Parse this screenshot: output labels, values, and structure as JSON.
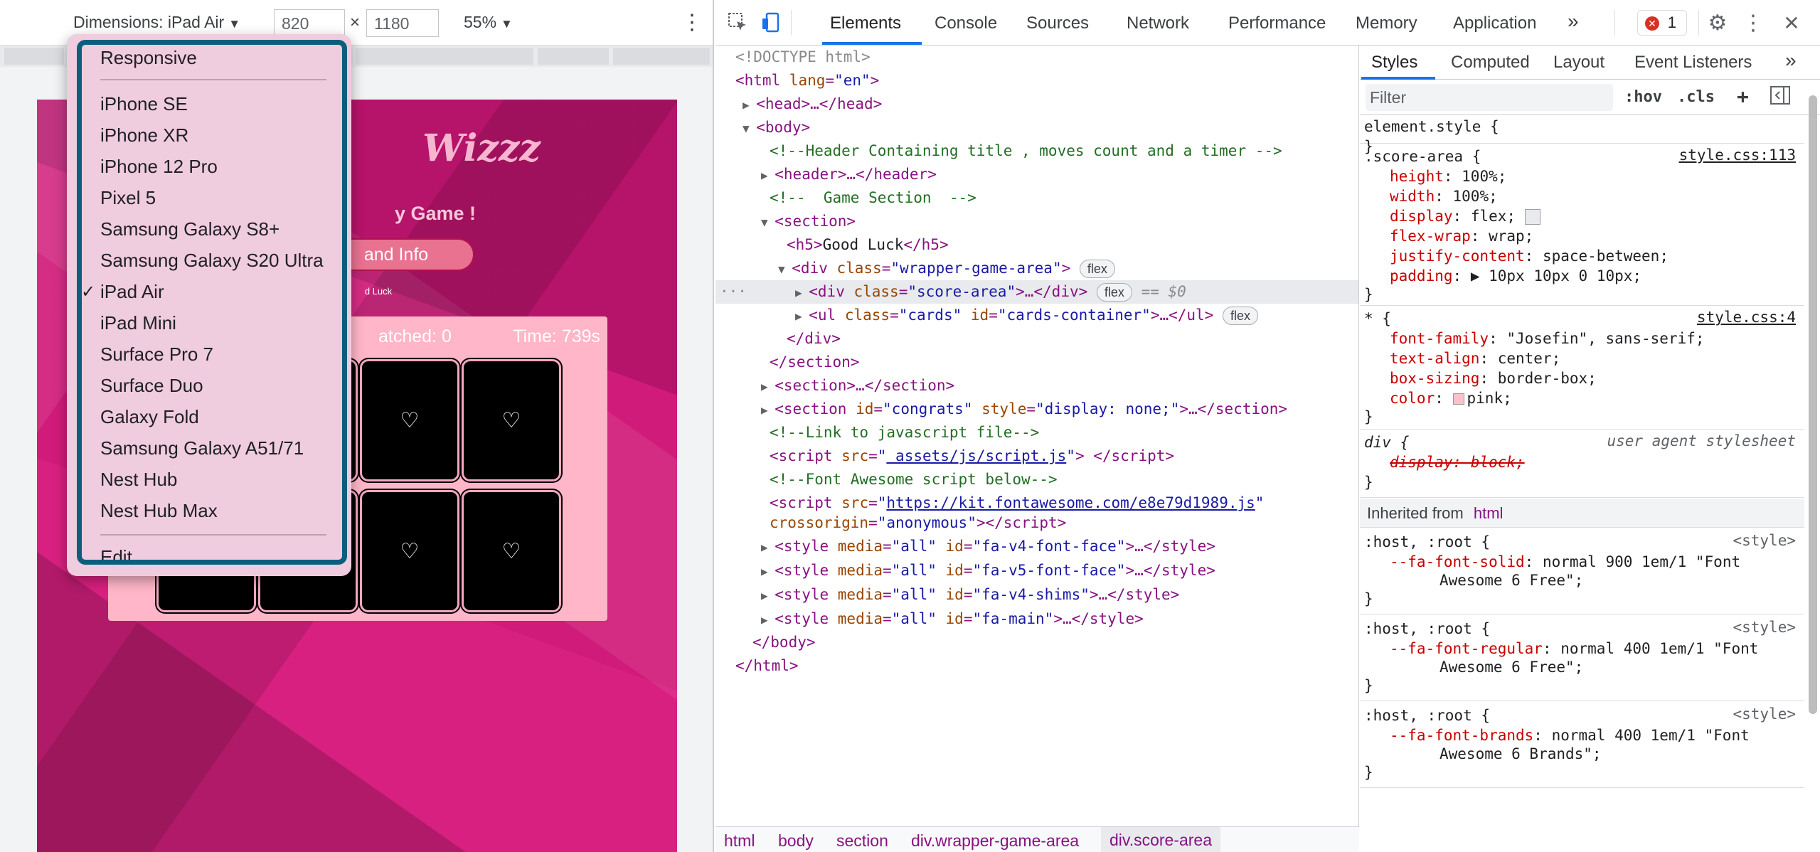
{
  "device_toolbar": {
    "dimensions_label": "Dimensions: iPad Air",
    "width": "820",
    "height": "1180",
    "times": "×",
    "zoom": "55%",
    "caret": "▼",
    "more": "⋮"
  },
  "page": {
    "title": "Wizzz",
    "subtitle": "y Game !",
    "button": "and Info",
    "small_text": "d Luck",
    "matched": "atched: 0",
    "time": "Time: 739s",
    "card_icon": "♡"
  },
  "device_menu": {
    "items": [
      "Responsive",
      "iPhone SE",
      "iPhone XR",
      "iPhone 12 Pro",
      "Pixel 5",
      "Samsung Galaxy S8+",
      "Samsung Galaxy S20 Ultra",
      "iPad Air",
      "iPad Mini",
      "Surface Pro 7",
      "Surface Duo",
      "Galaxy Fold",
      "Samsung Galaxy A51/71",
      "Nest Hub",
      "Nest Hub Max",
      "Edit..."
    ],
    "selected": "iPad Air",
    "check": "✓"
  },
  "devtools": {
    "tabs": [
      "Elements",
      "Console",
      "Sources",
      "Network",
      "Performance",
      "Memory",
      "Application"
    ],
    "more_tabs": "»",
    "error_count": "1",
    "error_icon": "✕",
    "settings_icon": "⚙",
    "more": "⋮",
    "close": "✕"
  },
  "dom_tree": {
    "doctype": "<!DOCTYPE html>",
    "html_open": "<html lang=\"en\">",
    "head": "<head>…</head>",
    "body_open": "<body>",
    "comment_header": "<!--Header Containing title , moves count and a timer -->",
    "header": "<header>…</header>",
    "comment_game": "<!--  Game Section  -->",
    "section_open": "<section>",
    "h5_open": "<h5>",
    "h5_text": "Good Luck",
    "h5_close": "</h5>",
    "wrapper_div": "wrapper-game-area",
    "flex": "flex",
    "score_area": "score-area",
    "sel_marker": "== $0",
    "ul_class": "cards",
    "ul_id": "cards-container",
    "div_close": "</div>",
    "section_close": "</section>",
    "section_collapsed": "<section>…</section>",
    "congrats_id": "congrats",
    "congrats_style": "display: none;",
    "comment_js": "<!--Link to javascript file-->",
    "script_src": " assets/js/script.js",
    "comment_fa": "<!--Font Awesome script below-->",
    "fa_src": "https://kit.fontawesome.com/e8e79d1989.js",
    "crossorigin": "anonymous",
    "styles": [
      "fa-v4-font-face",
      "fa-v5-font-face",
      "fa-v4-shims",
      "fa-main"
    ],
    "body_close": "</body>",
    "html_close": "</html>",
    "dots": "···"
  },
  "breadcrumbs": [
    "html",
    "body",
    "section",
    "div.wrapper-game-area",
    "div.score-area"
  ],
  "styles_pane": {
    "tabs": [
      "Styles",
      "Computed",
      "Layout",
      "Event Listeners"
    ],
    "more": "»",
    "filter_placeholder": "Filter",
    "hov": ":hov",
    ".cls": ".cls",
    "plus": "+",
    "element_style": "element.style {",
    "close_brace": "}",
    "score_selector": ".score-area {",
    "score_source": "style.css:113",
    "score_props": [
      {
        "name": "height",
        "value": "100%;"
      },
      {
        "name": "width",
        "value": "100%;"
      },
      {
        "name": "display",
        "value": "flex;"
      },
      {
        "name": "flex-wrap",
        "value": "wrap;"
      },
      {
        "name": "justify-content",
        "value": "space-between;"
      },
      {
        "name": "padding",
        "value": "▶ 10px 10px 0 10px;"
      }
    ],
    "star_selector": "* {",
    "star_source": "style.css:4",
    "star_props": [
      {
        "name": "font-family",
        "value": "\"Josefin\", sans-serif;"
      },
      {
        "name": "text-align",
        "value": "center;"
      },
      {
        "name": "box-sizing",
        "value": "border-box;"
      },
      {
        "name": "color",
        "value": "pink;"
      }
    ],
    "div_selector": "div {",
    "ua_source": "user agent stylesheet",
    "ua_prop": "display: block;",
    "inherited_label": "Inherited from",
    "inherited_from": "html",
    "root_selector": ":host, :root {",
    "style_source": "<style>",
    "root_rules": [
      {
        "name": "--fa-font-solid",
        "value": "normal 900 1em/1 \"Font",
        "value2": "Awesome 6 Free\";"
      },
      {
        "name": "--fa-font-regular",
        "value": "normal 400 1em/1 \"Font",
        "value2": "Awesome 6 Free\";"
      },
      {
        "name": "--fa-font-brands",
        "value": "normal 400 1em/1 \"Font",
        "value2": "Awesome 6 Brands\";"
      }
    ]
  },
  "colors": {
    "accent": "#1a73e8",
    "focus_ring": "#0b5f7d",
    "page_bg": "#d11b7a",
    "game_area": "#ffb6c8"
  }
}
